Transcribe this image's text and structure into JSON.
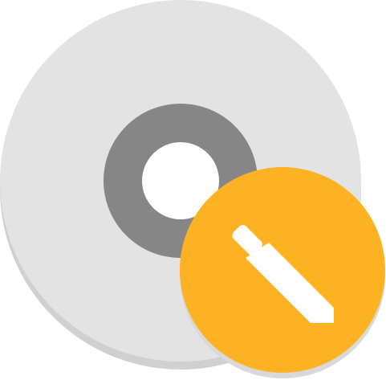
{
  "icon": {
    "name": "disc-burn-edit-icon",
    "disc_color": "#e3e3e3",
    "disc_shadow_color": "#d0d0d0",
    "hub_ring_color": "#868686",
    "center_hole_color": "#ffffff",
    "badge_color": "#fdb223",
    "badge_shadow_color": "#d9d9d9",
    "pencil_color": "#ffffff",
    "badge_icon_name": "pencil-icon"
  }
}
